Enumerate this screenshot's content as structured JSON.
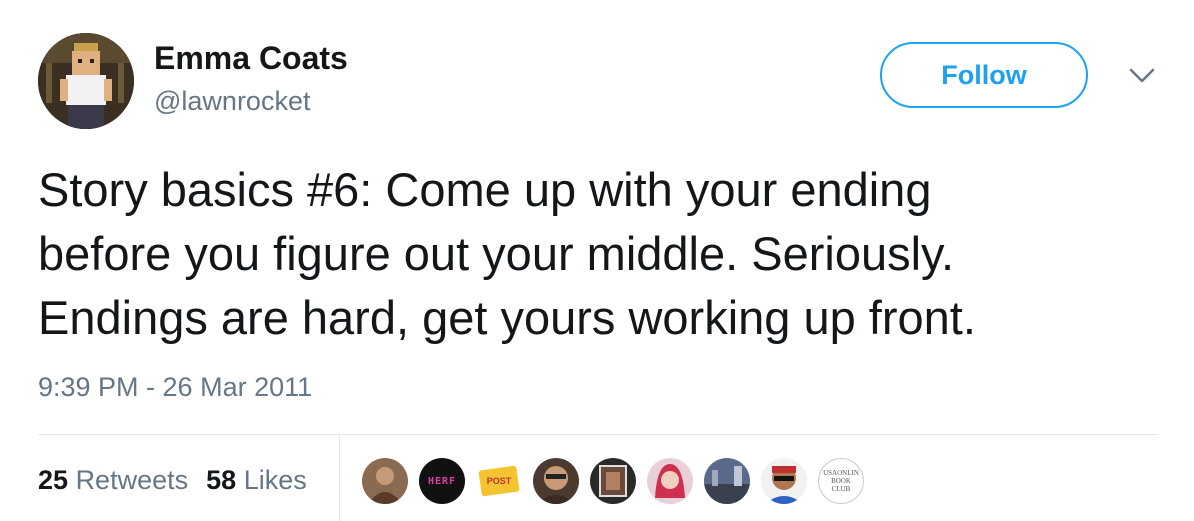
{
  "author": {
    "name": "Emma Coats",
    "handle": "@lawnrocket"
  },
  "actions": {
    "follow_label": "Follow",
    "more_icon": "chevron-down-icon"
  },
  "tweet": {
    "lines": [
      "Story basics #6: Come up with your ending",
      "before you figure out your middle. Seriously.",
      "Endings are hard, get yours working up front."
    ],
    "timestamp": "9:39 PM - 26 Mar 2011"
  },
  "stats": {
    "retweets_count": "25",
    "retweets_label": "Retweets",
    "likes_count": "58",
    "likes_label": "Likes"
  },
  "likers": [
    {
      "icon": "liker-avatar-1"
    },
    {
      "icon": "liker-avatar-2",
      "text": "HERF"
    },
    {
      "icon": "liker-avatar-3",
      "text": "POST"
    },
    {
      "icon": "liker-avatar-4"
    },
    {
      "icon": "liker-avatar-5"
    },
    {
      "icon": "liker-avatar-6"
    },
    {
      "icon": "liker-avatar-7"
    },
    {
      "icon": "liker-avatar-8"
    },
    {
      "icon": "liker-avatar-9",
      "text": "USAONLIN BOOK CLUB"
    }
  ],
  "colors": {
    "brand": "#1da1f2",
    "text": "#14171a",
    "secondary": "#657786",
    "divider": "#e1e8ed"
  }
}
